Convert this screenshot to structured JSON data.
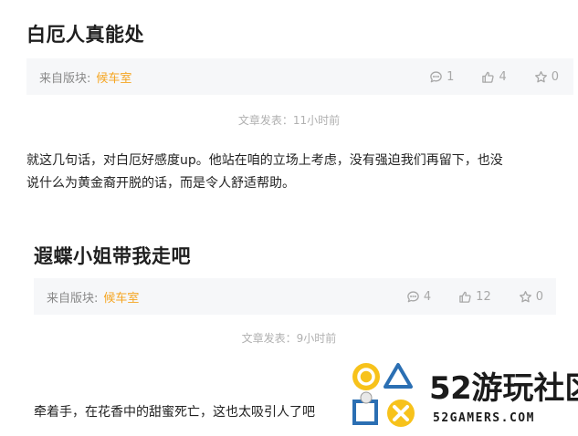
{
  "posts": [
    {
      "title": "白厄人真能处",
      "board_label": "来自版块:",
      "board_name": "候车室",
      "comments": "1",
      "likes": "4",
      "favorites": "0",
      "time": "文章发表：11小时前",
      "body_lines": [
        "就这几句话，对白厄好感度up。他站在咱的立场上考虑，没有强迫我们再留下，也没",
        "说什么为黄金裔开脱的话，而是令人舒适帮助。"
      ]
    },
    {
      "title": "遐蝶小姐带我走吧",
      "board_label": "来自版块:",
      "board_name": "候车室",
      "comments": "4",
      "likes": "12",
      "favorites": "0",
      "time": "文章发表：9小时前",
      "body_lines": [
        "牵着手，在花香中的甜蜜死亡，这也太吸引人了吧"
      ]
    }
  ],
  "watermark": {
    "number": "52",
    "name": "游玩社区",
    "domain": "52GAMERS.COM"
  },
  "colors": {
    "board": "#f5a623",
    "meta_bg": "#f6f7f9",
    "muted": "#a8a8a8"
  }
}
